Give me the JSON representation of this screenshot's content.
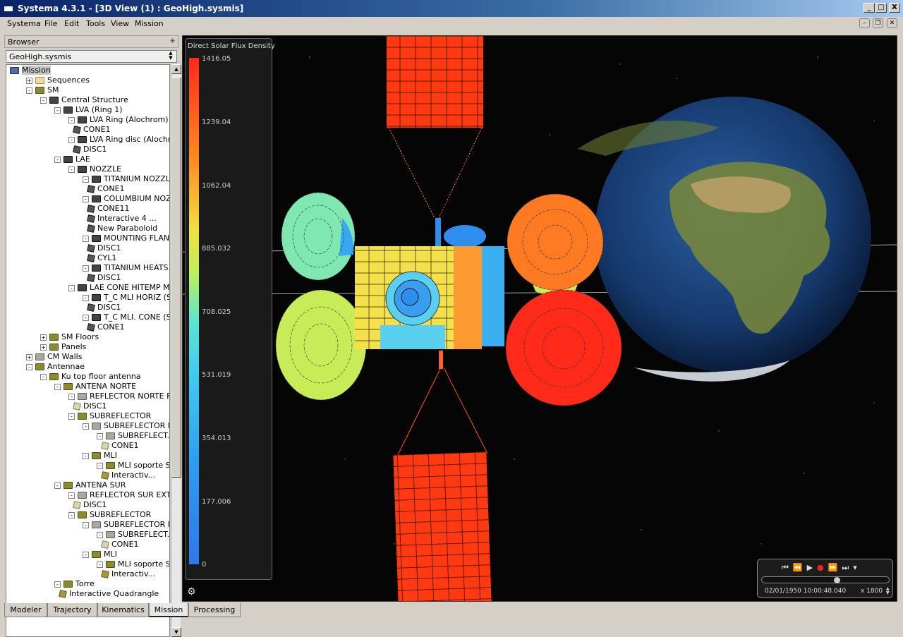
{
  "window": {
    "title": "Systema 4.3.1 - [3D View (1) : GeoHigh.sysmis]",
    "controls": {
      "minimize": "_",
      "maximize": "□",
      "close": "X"
    }
  },
  "menu": [
    "Systema",
    "File",
    "Edit",
    "Tools",
    "View",
    "Mission"
  ],
  "browser": {
    "header": "Browser",
    "combo_value": "GeoHigh.sysmis",
    "tree": [
      {
        "label": "Mission",
        "level": 0,
        "icon": "mission-icon",
        "expander": "",
        "selected": true
      },
      {
        "label": "Sequences",
        "level": 1,
        "icon": "folder-beige-icon",
        "expander": "+"
      },
      {
        "label": "SM",
        "level": 1,
        "icon": "folder-olive-icon",
        "expander": "-"
      },
      {
        "label": "Central Structure",
        "level": 2,
        "icon": "dark-folder-icon",
        "expander": "-"
      },
      {
        "label": "LVA (Ring 1)",
        "level": 3,
        "icon": "dark-folder-icon",
        "expander": "-"
      },
      {
        "label": "LVA Ring (Alochrom)",
        "level": 4,
        "icon": "dark-folder-icon",
        "expander": "-"
      },
      {
        "label": "CONE1",
        "level": 5,
        "icon": "dark-cube-icon",
        "expander": ""
      },
      {
        "label": "LVA Ring disc (Alochrom)",
        "level": 4,
        "icon": "dark-folder-icon",
        "expander": "-"
      },
      {
        "label": "DISC1",
        "level": 5,
        "icon": "dark-cube-icon",
        "expander": ""
      },
      {
        "label": "LAE",
        "level": 3,
        "icon": "dark-folder-icon",
        "expander": "-"
      },
      {
        "label": "NOZZLE",
        "level": 4,
        "icon": "dark-folder-icon",
        "expander": "-"
      },
      {
        "label": "TITANIUM NOZZLE",
        "level": 5,
        "icon": "dark-folder-icon",
        "expander": "-"
      },
      {
        "label": "CONE1",
        "level": 6,
        "icon": "dark-cube-icon",
        "expander": ""
      },
      {
        "label": "COLUMBIUM NOZ...",
        "level": 5,
        "icon": "dark-folder-icon",
        "expander": "-"
      },
      {
        "label": "CONE11",
        "level": 6,
        "icon": "dark-cube-icon",
        "expander": ""
      },
      {
        "label": "Interactive 4 ...",
        "level": 6,
        "icon": "dark-cube-icon",
        "expander": ""
      },
      {
        "label": "New Paraboloid",
        "level": 6,
        "icon": "dark-cube-icon",
        "expander": ""
      },
      {
        "label": "MOUNTING FLAN...",
        "level": 5,
        "icon": "dark-folder-icon",
        "expander": "-"
      },
      {
        "label": "DISC1",
        "level": 6,
        "icon": "dark-cube-icon",
        "expander": ""
      },
      {
        "label": "CYL1",
        "level": 6,
        "icon": "dark-cube-icon",
        "expander": ""
      },
      {
        "label": "TITANIUM HEATS...",
        "level": 5,
        "icon": "dark-folder-icon",
        "expander": "-"
      },
      {
        "label": "DISC1",
        "level": 6,
        "icon": "dark-cube-icon",
        "expander": ""
      },
      {
        "label": "LAE CONE HITEMP ML...",
        "level": 4,
        "icon": "dark-folder-icon",
        "expander": "-"
      },
      {
        "label": "T_C MLI HORIZ (S...",
        "level": 5,
        "icon": "dark-folder-icon",
        "expander": "-"
      },
      {
        "label": "DISC1",
        "level": 6,
        "icon": "dark-cube-icon",
        "expander": ""
      },
      {
        "label": "T_C MLI. CONE (S...",
        "level": 5,
        "icon": "dark-folder-icon",
        "expander": "-"
      },
      {
        "label": "CONE1",
        "level": 6,
        "icon": "dark-cube-icon",
        "expander": ""
      },
      {
        "label": "SM Floors",
        "level": 2,
        "icon": "folder-olive-icon",
        "expander": "+"
      },
      {
        "label": "Panels",
        "level": 2,
        "icon": "folder-olive-icon",
        "expander": "+"
      },
      {
        "label": "CM Walls",
        "level": 1,
        "icon": "grey-folder-icon",
        "expander": "+"
      },
      {
        "label": "Antennae",
        "level": 1,
        "icon": "folder-olive-icon",
        "expander": "-"
      },
      {
        "label": "Ku top floor antenna",
        "level": 2,
        "icon": "folder-olive-icon",
        "expander": "-"
      },
      {
        "label": "ANTENA NORTE",
        "level": 3,
        "icon": "folder-olive-icon",
        "expander": "-"
      },
      {
        "label": "REFLECTOR NORTE F...",
        "level": 4,
        "icon": "grey-folder-icon",
        "expander": "-"
      },
      {
        "label": "DISC1",
        "level": 5,
        "icon": "light-cube-icon",
        "expander": ""
      },
      {
        "label": "SUBREFLECTOR",
        "level": 4,
        "icon": "folder-olive-icon",
        "expander": "-"
      },
      {
        "label": "SUBREFLECTOR MLI",
        "level": 5,
        "icon": "grey-folder-icon",
        "expander": "-"
      },
      {
        "label": "SUBREFLECT...",
        "level": 6,
        "icon": "grey-folder-icon",
        "expander": "-"
      },
      {
        "label": "CONE1",
        "level": 7,
        "icon": "light-cube-icon",
        "expander": ""
      },
      {
        "label": "MLI",
        "level": 5,
        "icon": "folder-olive-icon",
        "expander": "-"
      },
      {
        "label": "MLI soporte S...",
        "level": 6,
        "icon": "folder-olive-icon",
        "expander": "-"
      },
      {
        "label": "Interactiv...",
        "level": 7,
        "icon": "olive-cube-icon",
        "expander": ""
      },
      {
        "label": "ANTENA SUR",
        "level": 3,
        "icon": "folder-olive-icon",
        "expander": "-"
      },
      {
        "label": "REFLECTOR SUR EXT",
        "level": 4,
        "icon": "grey-folder-icon",
        "expander": "-"
      },
      {
        "label": "DISC1",
        "level": 5,
        "icon": "light-cube-icon",
        "expander": ""
      },
      {
        "label": "SUBREFLECTOR",
        "level": 4,
        "icon": "folder-olive-icon",
        "expander": "-"
      },
      {
        "label": "SUBREFLECTOR MLI",
        "level": 5,
        "icon": "grey-folder-icon",
        "expander": "-"
      },
      {
        "label": "SUBREFLECT...",
        "level": 6,
        "icon": "grey-folder-icon",
        "expander": "-"
      },
      {
        "label": "CONE1",
        "level": 7,
        "icon": "light-cube-icon",
        "expander": ""
      },
      {
        "label": "MLI",
        "level": 5,
        "icon": "folder-olive-icon",
        "expander": "-"
      },
      {
        "label": "MLI soporte S...",
        "level": 6,
        "icon": "folder-olive-icon",
        "expander": "-"
      },
      {
        "label": "Interactiv...",
        "level": 7,
        "icon": "olive-cube-icon",
        "expander": ""
      },
      {
        "label": "Torre",
        "level": 3,
        "icon": "folder-olive-icon",
        "expander": "-"
      },
      {
        "label": "Interactive Quadrangle",
        "level": 4,
        "icon": "olive-cube-icon",
        "expander": ""
      }
    ]
  },
  "view3d": {
    "legend": {
      "title": "Direct Solar Flux Density",
      "values": [
        "1416.05",
        "1239.04",
        "1062.04",
        "885.032",
        "708.025",
        "531.019",
        "354.013",
        "177.006",
        "0"
      ]
    },
    "colors": {
      "hot": "#ff2a1a",
      "orange": "#ff7a20",
      "yellow": "#f4e04a",
      "lime": "#c8ec58",
      "mint": "#7ee8b0",
      "cyan": "#5ad0f0",
      "blue": "#2e8ef0"
    },
    "player": {
      "timestamp": "02/01/1950 10:00:48.040",
      "speed": "x 1800",
      "controls": "⏮ ⏪ ▶ ● ⏩ ⏭ ▾"
    }
  },
  "tabs": [
    "Modeler",
    "Trajectory",
    "Kinematics",
    "Mission",
    "Processing"
  ],
  "active_tab": "Mission"
}
